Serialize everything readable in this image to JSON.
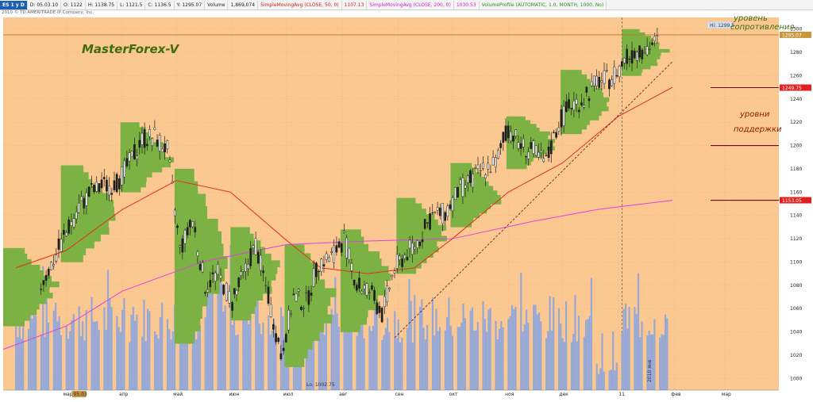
{
  "header": {
    "symbol": "ES 1 y D",
    "date": "D: 05.03.10",
    "open": "O: 1122",
    "high": "H: 1138.75",
    "low": "L: 1121.5",
    "close": "C: 1136.5",
    "y_value": "Y: 1295.07",
    "volume_label": "Volume",
    "volume_value": "1,869,074",
    "sma50_label": "SimpleMovingAvg (CLOSE, 50, 0)",
    "sma50_value": "1107.13",
    "sma200_label": "SimpleMovingAvg (CLOSE, 200, 0)",
    "sma200_value": "1030.53",
    "vp_label": "VolumeProfile (AUTOMATIC, 1.0, MONTH, 1000, No)",
    "copyright": "2010 © TD AMERITRADE IP Company, Inc."
  },
  "annotations": {
    "brand": "MasterForex-V",
    "resistance": "уровень сопротивления",
    "support_1": "уровни",
    "support_2": "поддержки",
    "hi": "Hi: 1299.5",
    "lo": "Lo: 1002.75",
    "year_2010": "2010 янв",
    "year_11": "11"
  },
  "price_labels": {
    "resistance": "1295.07",
    "support_1": "1249.75",
    "support_2": "1153.05"
  },
  "colors": {
    "background": "#fcc891",
    "volume": "#8fa6dc",
    "profile": "#7cb243",
    "candles": "#1f1f1f",
    "sma50": "#e03020",
    "sma200": "#e040e0",
    "trendline": "#7a2020",
    "resistance_line": "#b87a28",
    "support_line": "#6a1010",
    "label_text": "#8a1a00",
    "brand_text": "#3d6e0c"
  },
  "chart_data": {
    "type": "candlestick",
    "title": "ES 1 y D",
    "ylim": [
      990,
      1310
    ],
    "y_ticks": [
      1000,
      1020,
      1040,
      1060,
      1080,
      1100,
      1120,
      1140,
      1160,
      1180,
      1200,
      1220,
      1240,
      1260,
      1280,
      1300
    ],
    "x_ticks": [
      "мар",
      "05.03",
      "апр",
      "май",
      "июн",
      "июл",
      "авг",
      "сен",
      "окт",
      "ноя",
      "дек",
      "11",
      "фев",
      "мар"
    ],
    "grid": true,
    "close_series": [
      {
        "date": "2010-02-15",
        "close": 1080
      },
      {
        "date": "2010-02-22",
        "close": 1102
      },
      {
        "date": "2010-03-01",
        "close": 1125
      },
      {
        "date": "2010-03-08",
        "close": 1148
      },
      {
        "date": "2010-03-15",
        "close": 1160
      },
      {
        "date": "2010-03-22",
        "close": 1165
      },
      {
        "date": "2010-03-29",
        "close": 1168
      },
      {
        "date": "2010-04-05",
        "close": 1185
      },
      {
        "date": "2010-04-12",
        "close": 1205
      },
      {
        "date": "2010-04-19",
        "close": 1208
      },
      {
        "date": "2010-04-26",
        "close": 1196
      },
      {
        "date": "2010-05-03",
        "close": 1110
      },
      {
        "date": "2010-05-10",
        "close": 1135
      },
      {
        "date": "2010-05-17",
        "close": 1080
      },
      {
        "date": "2010-05-24",
        "close": 1090
      },
      {
        "date": "2010-06-01",
        "close": 1065
      },
      {
        "date": "2010-06-07",
        "close": 1088
      },
      {
        "date": "2010-06-14",
        "close": 1115
      },
      {
        "date": "2010-06-21",
        "close": 1070
      },
      {
        "date": "2010-06-28",
        "close": 1020
      },
      {
        "date": "2010-07-05",
        "close": 1070
      },
      {
        "date": "2010-07-12",
        "close": 1065
      },
      {
        "date": "2010-07-19",
        "close": 1100
      },
      {
        "date": "2010-07-26",
        "close": 1105
      },
      {
        "date": "2010-08-02",
        "close": 1120
      },
      {
        "date": "2010-08-09",
        "close": 1080
      },
      {
        "date": "2010-08-16",
        "close": 1075
      },
      {
        "date": "2010-08-23",
        "close": 1055
      },
      {
        "date": "2010-08-30",
        "close": 1095
      },
      {
        "date": "2010-09-06",
        "close": 1108
      },
      {
        "date": "2010-09-13",
        "close": 1120
      },
      {
        "date": "2010-09-20",
        "close": 1140
      },
      {
        "date": "2010-09-27",
        "close": 1142
      },
      {
        "date": "2010-10-04",
        "close": 1160
      },
      {
        "date": "2010-10-11",
        "close": 1170
      },
      {
        "date": "2010-10-18",
        "close": 1180
      },
      {
        "date": "2010-10-25",
        "close": 1185
      },
      {
        "date": "2010-11-01",
        "close": 1215
      },
      {
        "date": "2010-11-08",
        "close": 1200
      },
      {
        "date": "2010-11-15",
        "close": 1195
      },
      {
        "date": "2010-11-22",
        "close": 1185
      },
      {
        "date": "2010-11-29",
        "close": 1220
      },
      {
        "date": "2010-12-06",
        "close": 1235
      },
      {
        "date": "2010-12-13",
        "close": 1240
      },
      {
        "date": "2010-12-20",
        "close": 1255
      },
      {
        "date": "2010-12-27",
        "close": 1257
      },
      {
        "date": "2011-01-03",
        "close": 1270
      },
      {
        "date": "2011-01-10",
        "close": 1280
      },
      {
        "date": "2011-01-17",
        "close": 1285
      },
      {
        "date": "2011-01-24",
        "close": 1290
      }
    ],
    "levels": {
      "resistance": 1295.07,
      "support": [
        1249.75,
        1153.05,
        1200
      ],
      "hi": 1299.5,
      "lo": 1002.75
    }
  }
}
